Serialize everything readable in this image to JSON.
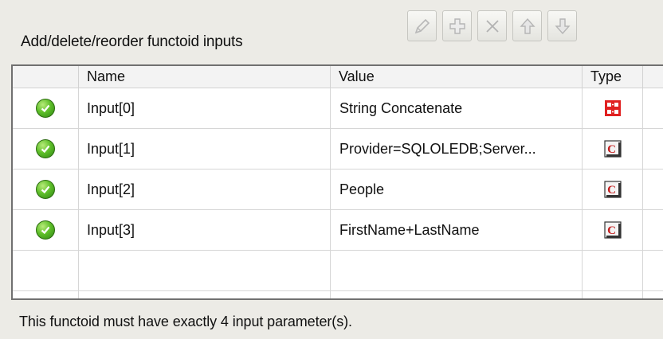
{
  "panel": {
    "title": "Add/delete/reorder functoid inputs",
    "footer_message": "This functoid must have exactly 4 input parameter(s)."
  },
  "toolbar": {
    "buttons": [
      {
        "name": "edit",
        "icon": "pencil-icon"
      },
      {
        "name": "add",
        "icon": "plus-icon"
      },
      {
        "name": "delete",
        "icon": "x-icon"
      },
      {
        "name": "move-up",
        "icon": "arrow-up-icon"
      },
      {
        "name": "move-down",
        "icon": "arrow-down-icon"
      }
    ]
  },
  "grid": {
    "columns": {
      "status": "",
      "name": "Name",
      "value": "Value",
      "type": "Type"
    },
    "rows": [
      {
        "name": "Input[0]",
        "value": "String Concatenate",
        "type": "functoid-link-icon",
        "status": "check-icon"
      },
      {
        "name": "Input[1]",
        "value": "Provider=SQLOLEDB;Server...",
        "type": "constant-icon",
        "status": "check-icon"
      },
      {
        "name": "Input[2]",
        "value": "People",
        "type": "constant-icon",
        "status": "check-icon"
      },
      {
        "name": "Input[3]",
        "value": "FirstName+LastName",
        "type": "constant-icon",
        "status": "check-icon"
      }
    ]
  },
  "colors": {
    "valid_green": "#5fbf2a",
    "functoid_red": "#e02020",
    "constant_red": "#c21b1b"
  }
}
